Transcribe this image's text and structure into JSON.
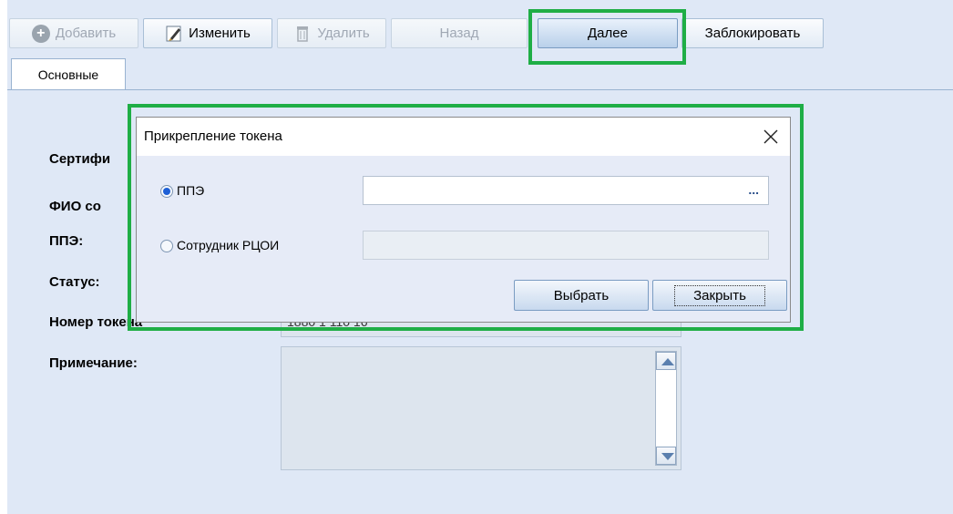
{
  "toolbar": {
    "add_label": "Добавить",
    "edit_label": "Изменить",
    "delete_label": "Удалить",
    "back_label": "Назад",
    "next_label": "Далее",
    "block_label": "Заблокировать"
  },
  "tabs": [
    {
      "label": "Основные"
    }
  ],
  "form": {
    "certificate_label": "Сертифи",
    "fio_label": "ФИО со",
    "ppe_label": "ППЭ:",
    "status_label": "Статус:",
    "token_number_label": "Номер токена",
    "token_number_value": "1880 1 110 16",
    "note_label": "Примечание:"
  },
  "dialog": {
    "title": "Прикрепление токена",
    "close_icon": "close-icon",
    "option_ppe": "ППЭ",
    "option_rcoi": "Сотрудник РЦОИ",
    "selected_option": "ППЭ",
    "ppe_input_value": "",
    "browse_label": "...",
    "select_button": "Выбрать",
    "close_button": "Закрыть"
  },
  "colors": {
    "highlight": "#1fae46",
    "window_bg": "#dfe8f6",
    "radio_selected": "#1d5fd6"
  }
}
